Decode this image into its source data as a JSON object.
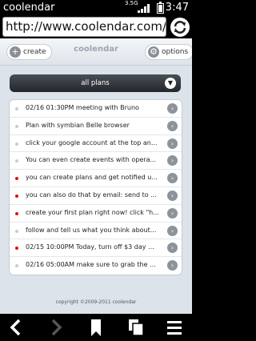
{
  "status": {
    "app_name": "coolendar",
    "network": "3.5G",
    "time": "3:47"
  },
  "browser": {
    "url": "http://www.coolendar.com/"
  },
  "header": {
    "create_label": "create",
    "brand": "coolendar",
    "options_label": "options"
  },
  "filter": {
    "label": "all plans"
  },
  "plans": [
    {
      "text": "02/16 01:30PM meeting with Bruno",
      "flag": "normal"
    },
    {
      "text": "Plan with symbian Belle browser",
      "flag": "normal"
    },
    {
      "text": "click your google account at the top an...",
      "flag": "normal"
    },
    {
      "text": "You can even create events with opera...",
      "flag": "normal"
    },
    {
      "text": "you can create plans and get notified u...",
      "flag": "important"
    },
    {
      "text": "you can also do that by email: send to ...",
      "flag": "important"
    },
    {
      "text": "create your first plan right now! click \"h...",
      "flag": "important"
    },
    {
      "text": "follow and tell us what you think about...",
      "flag": "normal"
    },
    {
      "text": "02/15 10:00PM Today, turn off $3 day ...",
      "flag": "important"
    },
    {
      "text": "02/16 05:00AM make sure to grab the ...",
      "flag": "normal"
    }
  ],
  "footer": {
    "copyright": "copyright ©2009-2011 coolendar"
  },
  "colors": {
    "important_dot": "#dd1111",
    "normal_dot": "#c8ccd1"
  }
}
